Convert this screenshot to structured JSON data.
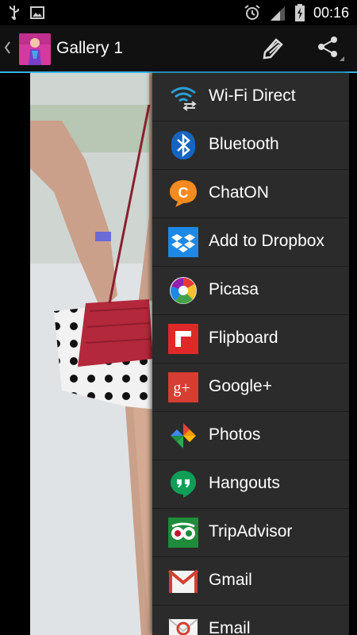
{
  "status_bar": {
    "time": "00:16",
    "icons": [
      "usb-icon",
      "image-icon",
      "alarm-icon",
      "signal-icon",
      "battery-icon"
    ]
  },
  "action_bar": {
    "title": "Gallery 1",
    "back_icon": "chevron-left-icon",
    "actions": [
      "edit-icon",
      "share-icon"
    ]
  },
  "share_menu": {
    "items": [
      {
        "label": "Wi-Fi Direct",
        "icon": "wifi-direct-icon"
      },
      {
        "label": "Bluetooth",
        "icon": "bluetooth-icon"
      },
      {
        "label": "ChatON",
        "icon": "chaton-icon"
      },
      {
        "label": "Add to Dropbox",
        "icon": "dropbox-icon"
      },
      {
        "label": "Picasa",
        "icon": "picasa-icon"
      },
      {
        "label": "Flipboard",
        "icon": "flipboard-icon"
      },
      {
        "label": "Google+",
        "icon": "google-plus-icon"
      },
      {
        "label": "Photos",
        "icon": "photos-icon"
      },
      {
        "label": "Hangouts",
        "icon": "hangouts-icon"
      },
      {
        "label": "TripAdvisor",
        "icon": "tripadvisor-icon"
      },
      {
        "label": "Gmail",
        "icon": "gmail-icon"
      },
      {
        "label": "Email",
        "icon": "email-icon"
      }
    ]
  },
  "colors": {
    "accent": "#33b5e5",
    "menu_bg": "#2b2b2b",
    "action_bar_bg": "#111111"
  }
}
